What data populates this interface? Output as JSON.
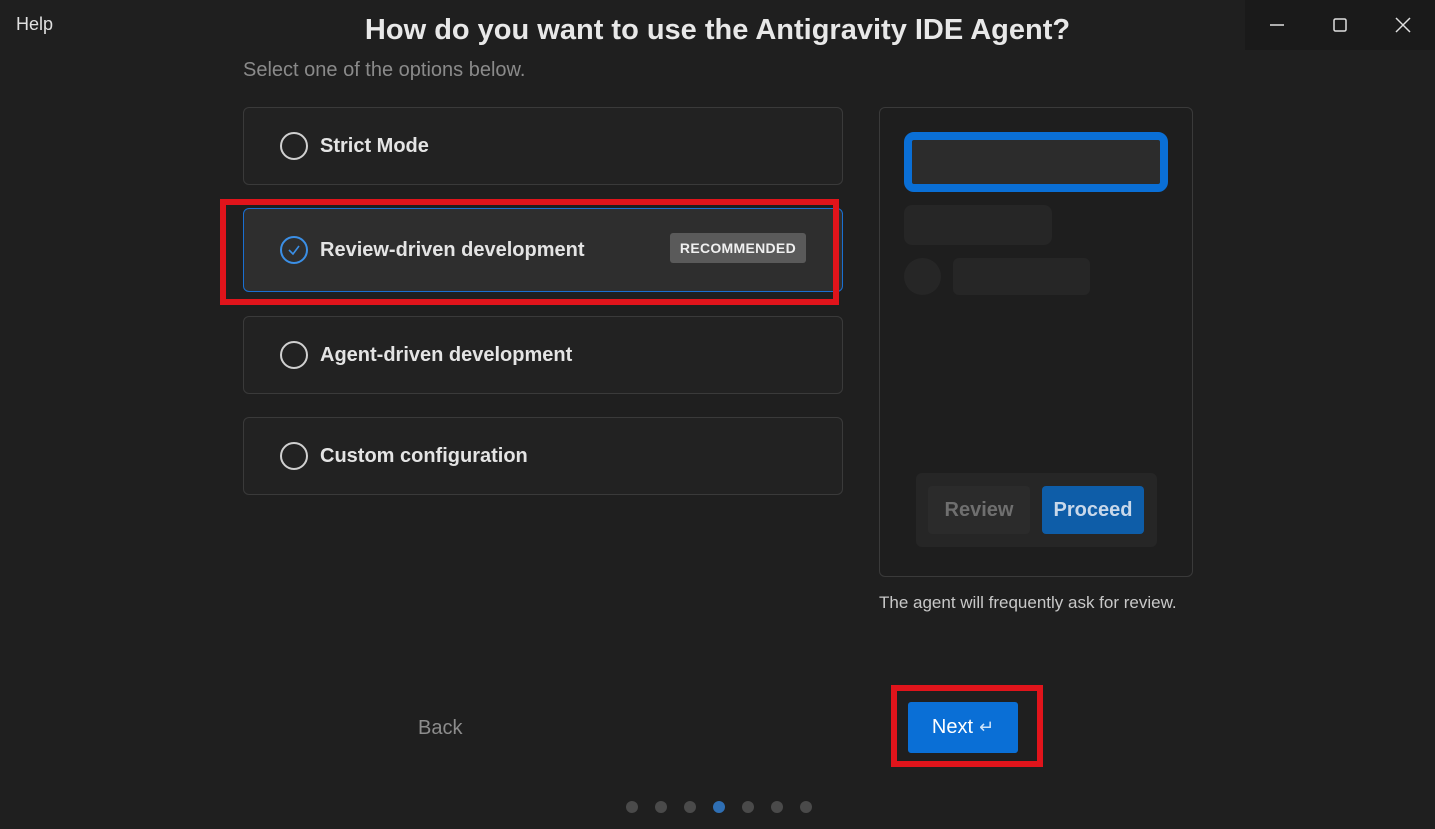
{
  "header": {
    "help_label": "Help",
    "title": "How do you want to use the Antigravity IDE Agent?",
    "subtitle": "Select one of the options below."
  },
  "window_controls": [
    "minimize-icon",
    "maximize-icon",
    "close-icon"
  ],
  "options": [
    {
      "label": "Strict Mode",
      "selected": false
    },
    {
      "label": "Review-driven development",
      "selected": true,
      "badge": "RECOMMENDED"
    },
    {
      "label": "Agent-driven development",
      "selected": false
    },
    {
      "label": "Custom configuration",
      "selected": false
    }
  ],
  "preview": {
    "review_label": "Review",
    "proceed_label": "Proceed",
    "caption": "The agent will frequently ask for review."
  },
  "footer": {
    "back_label": "Back",
    "next_label": "Next",
    "next_icon": "↵",
    "step_count": 7,
    "active_step": 4
  },
  "colors": {
    "accent": "#0a6fd6",
    "highlight": "#e0141b",
    "background": "#1f1f1f"
  }
}
